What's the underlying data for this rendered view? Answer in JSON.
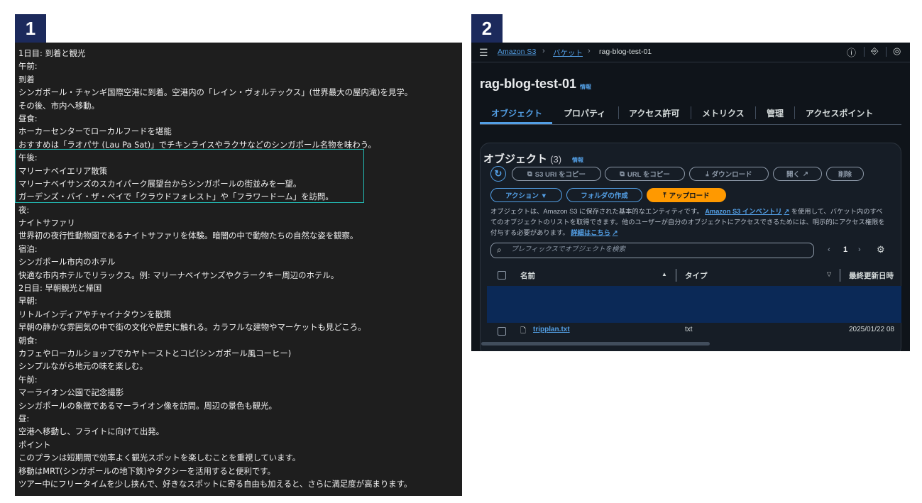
{
  "badges": {
    "left": "1",
    "right": "2"
  },
  "textfile": {
    "lines": [
      "1日目: 到着と観光",
      "午前:",
      "到着",
      "シンガポール・チャンギ国際空港に到着。空港内の「レイン・ヴォルテックス」(世界最大の屋内滝)を見学。",
      "その後、市内へ移動。",
      "昼食:",
      "ホーカーセンターでローカルフードを堪能",
      "おすすめは「ラオパサ (Lau Pa Sat)」でチキンライスやラクサなどのシンガポール名物を味わう。",
      "午後:",
      "マリーナベイエリア散策",
      "マリーナベイサンズのスカイパーク展望台からシンガポールの街並みを一望。",
      "ガーデンズ・バイ・ザ・ベイで「クラウドフォレスト」や「フラワードーム」を訪問。",
      "夜:",
      "ナイトサファリ",
      "世界初の夜行性動物園であるナイトサファリを体験。暗闇の中で動物たちの自然な姿を観察。",
      "宿泊:",
      "シンガポール市内のホテル",
      "快適な市内ホテルでリラックス。例: マリーナベイサンズやクラークキー周辺のホテル。",
      "2日目: 早朝観光と帰国",
      "早朝:",
      "リトルインディアやチャイナタウンを散策",
      "早朝の静かな雰囲気の中で街の文化や歴史に触れる。カラフルな建物やマーケットも見どころ。",
      "朝食:",
      "カフェやローカルショップでカヤトーストとコピ(シンガポール風コーヒー)",
      "シンプルながら地元の味を楽しむ。",
      "午前:",
      "マーライオン公園で記念撮影",
      "シンガポールの象徴であるマーライオン像を訪問。周辺の景色も観光。",
      "昼:",
      "空港へ移動し、フライトに向けて出発。",
      "ポイント",
      "このプランは短期間で効率よく観光スポットを楽しむことを重視しています。",
      "移動はMRT(シンガポールの地下鉄)やタクシーを活用すると便利です。",
      "ツアー中にフリータイムを少し挟んで、好きなスポットに寄る自由も加えると、さらに満足度が高まります。"
    ]
  },
  "s3": {
    "breadcrumb": {
      "root": "Amazon S3",
      "buckets": "バケット",
      "current": "rag-blog-test-01"
    },
    "bucket_title": "rag-blog-test-01",
    "info": "情報",
    "tabs": [
      "オブジェクト",
      "プロパティ",
      "アクセス許可",
      "メトリクス",
      "管理",
      "アクセスポイント"
    ],
    "objects": {
      "title": "オブジェクト",
      "count": "(3)",
      "buttons": {
        "copy_s3_uri": "S3 URI をコピー",
        "copy_url": "URL をコピー",
        "download": "ダウンロード",
        "open": "開く",
        "delete": "削除",
        "actions": "アクション ▼",
        "create_folder": "フォルダの作成",
        "upload": "アップロード"
      },
      "desc_1": "オブジェクトは、Amazon S3 に保存された基本的なエンティティです。",
      "desc_link_1": "Amazon S3 インベントリ",
      "desc_2": "を使用して、バケット内のすべてのオブジェクトのリストを取得できます。他のユーザーが自分のオブジェクトにアクセスできるためには、明示的にアクセス権限を付与する必要があります。",
      "desc_link_2": "詳細はこちら",
      "search_placeholder": "プレフィックスでオブジェクトを検索",
      "page": "1",
      "columns": {
        "name": "名前",
        "type": "タイプ",
        "modified": "最終更新日時"
      },
      "rows": [
        {
          "name": "tripplan.txt",
          "type": "txt",
          "modified": "2025/01/22 08"
        }
      ]
    },
    "colors": {
      "accent": "#539fe5",
      "upload": "#ff9900",
      "background": "#0f141a",
      "highlight_row": "#0b2957"
    }
  }
}
